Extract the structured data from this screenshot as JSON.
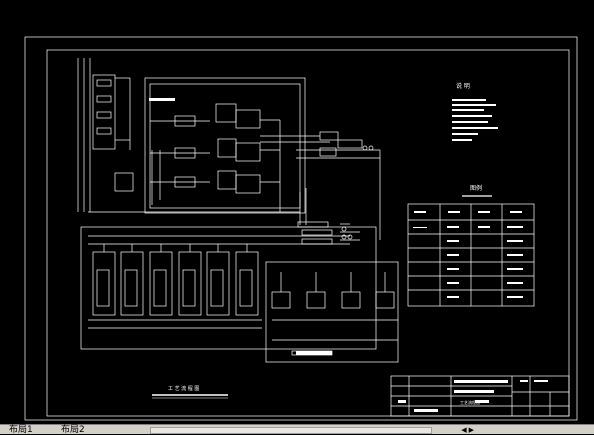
{
  "drawing": {
    "notes_title": "说 明",
    "legend_title": "图例",
    "diagram_title": "工 艺 流 程 图",
    "title_block_name": "工艺流程图"
  },
  "tabs": [
    {
      "label": "布局1"
    },
    {
      "label": "布局2"
    }
  ],
  "colors": {
    "background": "#000000",
    "lines": "#ffffff",
    "tabbar": "#d4d0c8"
  }
}
